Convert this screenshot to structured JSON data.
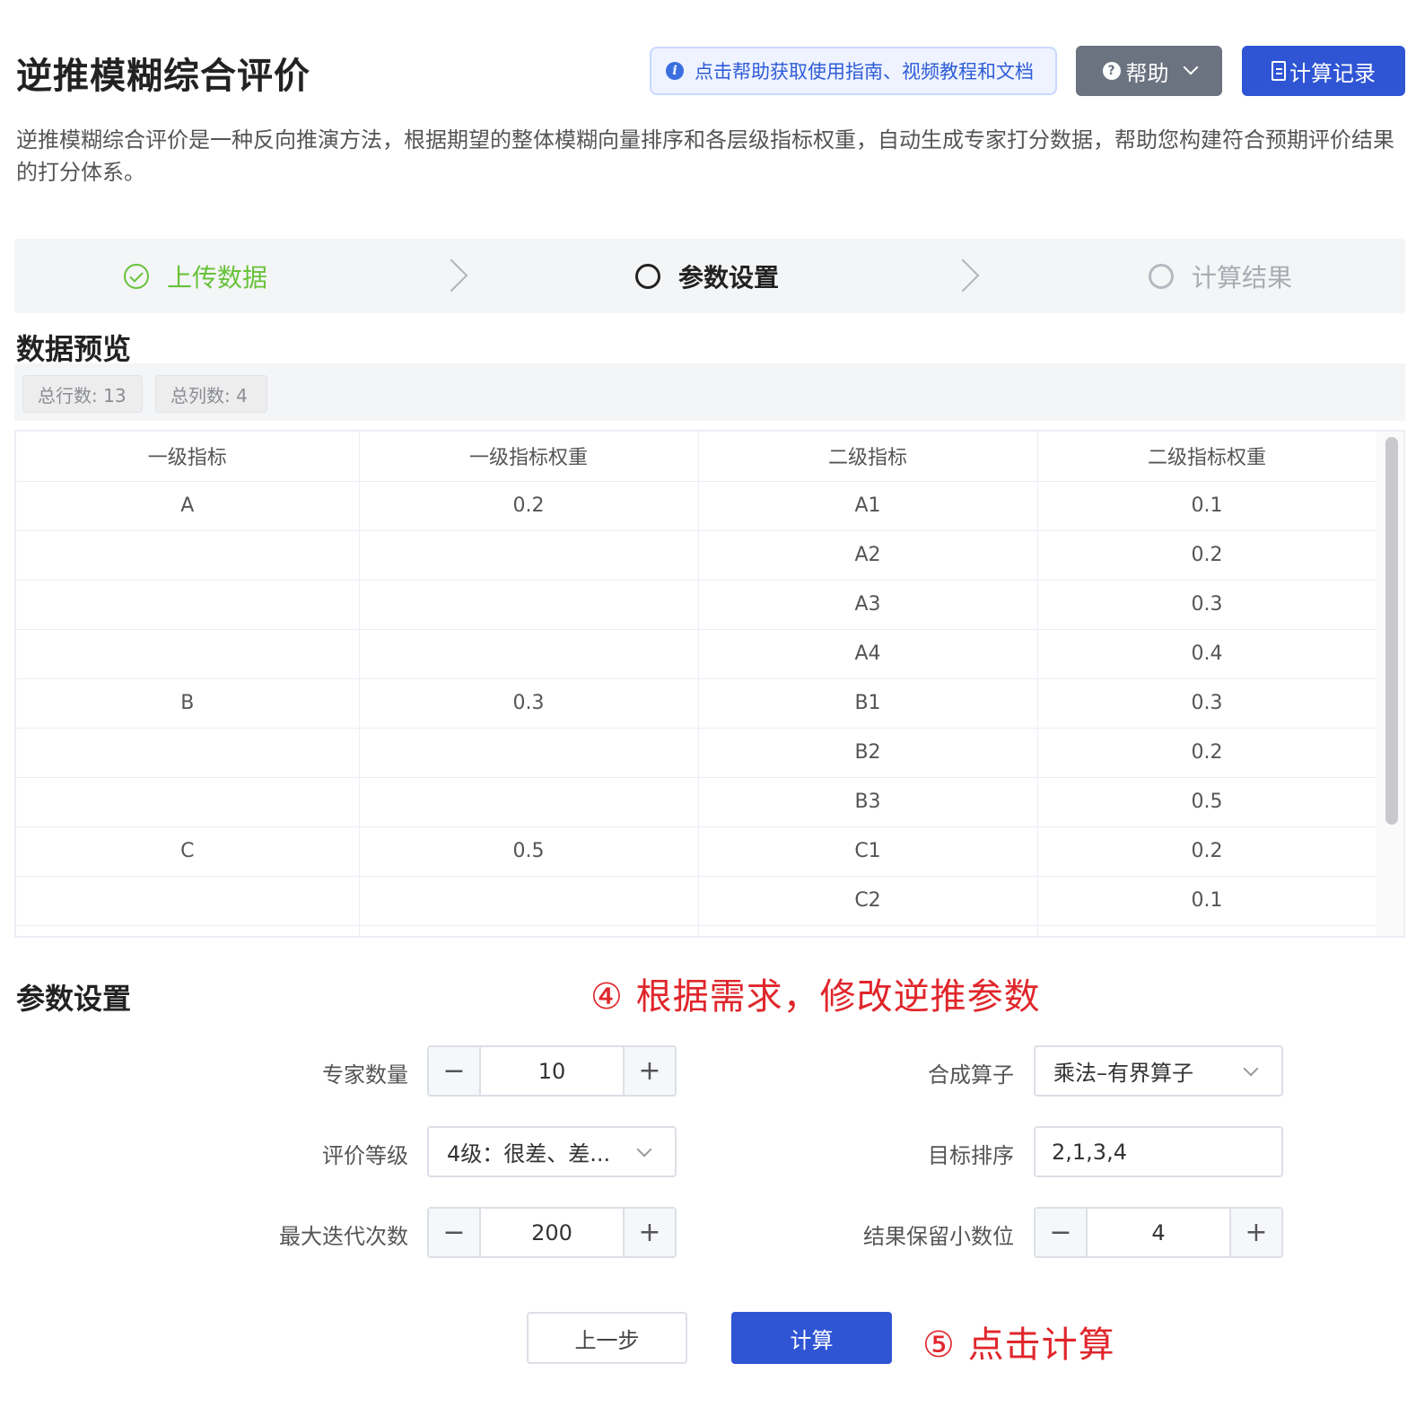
{
  "header": {
    "title": "逆推模糊综合评价",
    "help_tip": "点击帮助获取使用指南、视频教程和文档",
    "help_button": "帮助",
    "record_button": "计算记录"
  },
  "description": "逆推模糊综合评价是一种反向推演方法，根据期望的整体模糊向量排序和各层级指标权重，自动生成专家打分数据，帮助您构建符合预期评价结果的打分体系。",
  "steps": [
    {
      "label": "上传数据",
      "state": "done"
    },
    {
      "label": "参数设置",
      "state": "active"
    },
    {
      "label": "计算结果",
      "state": "wait"
    }
  ],
  "preview": {
    "title": "数据预览",
    "total_rows": "总行数: 13",
    "total_cols": "总列数: 4",
    "columns": [
      "一级指标",
      "一级指标权重",
      "二级指标",
      "二级指标权重"
    ],
    "rows": [
      [
        "A",
        "0.2",
        "A1",
        "0.1"
      ],
      [
        "",
        "",
        "A2",
        "0.2"
      ],
      [
        "",
        "",
        "A3",
        "0.3"
      ],
      [
        "",
        "",
        "A4",
        "0.4"
      ],
      [
        "B",
        "0.3",
        "B1",
        "0.3"
      ],
      [
        "",
        "",
        "B2",
        "0.2"
      ],
      [
        "",
        "",
        "B3",
        "0.5"
      ],
      [
        "C",
        "0.5",
        "C1",
        "0.2"
      ],
      [
        "",
        "",
        "C2",
        "0.1"
      ],
      [
        "",
        "",
        "",
        ""
      ]
    ]
  },
  "params": {
    "title": "参数设置",
    "annotation": "④ 根据需求，修改逆推参数",
    "expert_count": {
      "label": "专家数量",
      "value": "10"
    },
    "grade": {
      "label": "评价等级",
      "value": "4级：很差、差..."
    },
    "max_iter": {
      "label": "最大迭代次数",
      "value": "200"
    },
    "operator": {
      "label": "合成算子",
      "value": "乘法–有界算子"
    },
    "target_order": {
      "label": "目标排序",
      "value": "2,1,3,4"
    },
    "decimals": {
      "label": "结果保留小数位",
      "value": "4"
    },
    "minus": "−",
    "plus": "+"
  },
  "actions": {
    "prev": "上一步",
    "calc": "计算",
    "annotation": "⑤ 点击计算"
  },
  "colors": {
    "primary": "#2f55d4",
    "success": "#67c23a",
    "annotation": "#e0262b",
    "help_gray": "#6b7280"
  }
}
